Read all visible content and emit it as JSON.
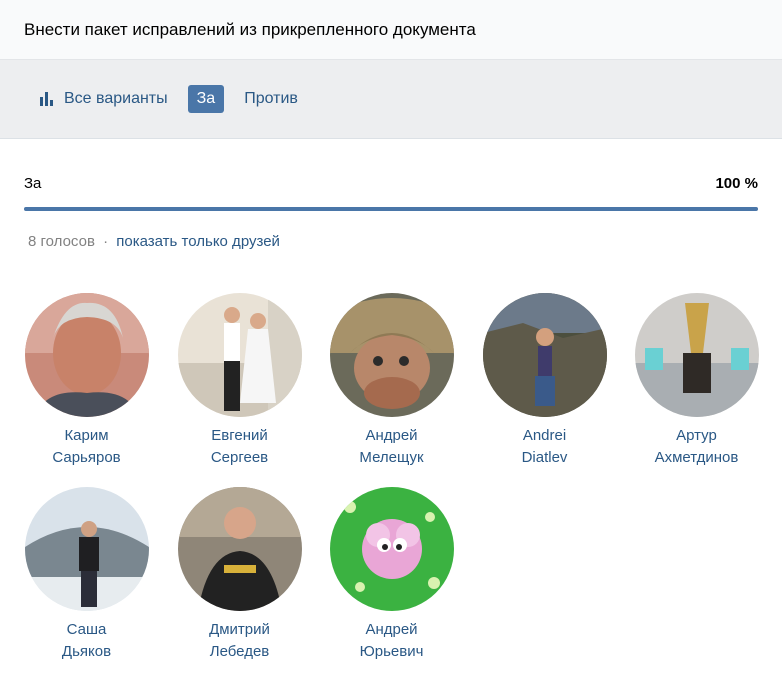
{
  "header": {
    "title": "Внести пакет исправлений из прикрепленного документа"
  },
  "tabs": [
    {
      "label": "Все варианты",
      "icon": "bar-chart-icon"
    },
    {
      "label": "За",
      "active": true
    },
    {
      "label": "Против"
    }
  ],
  "result": {
    "label": "За",
    "percent_text": "100 %",
    "fill": 1.0
  },
  "meta": {
    "votes": "8 голосов",
    "separator": "·",
    "friends_link": "показать только друзей"
  },
  "voters": [
    {
      "first": "Карим",
      "last": "Сарьяров"
    },
    {
      "first": "Евгений",
      "last": "Сергеев"
    },
    {
      "first": "Андрей",
      "last": "Мелещук"
    },
    {
      "first": "Andrei",
      "last": "Diatlev"
    },
    {
      "first": "Артур",
      "last": "Ахметдинов"
    },
    {
      "first": "Саша",
      "last": "Дьяков"
    },
    {
      "first": "Дмитрий",
      "last": "Лебедев"
    },
    {
      "first": "Андрей",
      "last": "Юрьевич"
    }
  ],
  "colors": {
    "accent": "#4a76a8",
    "link": "#2a5885",
    "muted": "#828282"
  }
}
